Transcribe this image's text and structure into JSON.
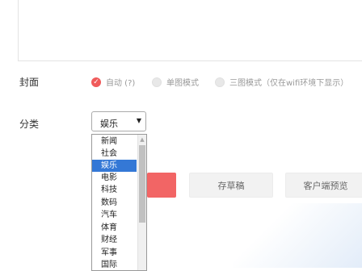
{
  "cover": {
    "label": "封面",
    "options": [
      {
        "label": "自动 (?)",
        "checked": true
      },
      {
        "label": "单图模式",
        "checked": false
      },
      {
        "label": "三图模式（仅在wifi环境下显示）",
        "checked": false
      }
    ]
  },
  "category": {
    "label": "分类",
    "selected": "娱乐",
    "options": [
      "新闻",
      "社会",
      "娱乐",
      "电影",
      "科技",
      "数码",
      "汽车",
      "体育",
      "财经",
      "军事",
      "国际"
    ]
  },
  "actions": {
    "save_draft": "存草稿",
    "client_preview": "客户端预览"
  },
  "colors": {
    "accent": "#f05a5a",
    "selected_option_bg": "#3478d6"
  }
}
